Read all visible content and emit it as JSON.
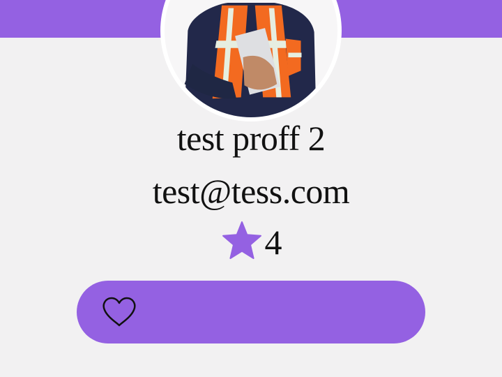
{
  "profile": {
    "name": "test proff 2",
    "email": "test@tess.com",
    "rating": "4",
    "avatar_icon": "worker-photo"
  },
  "icons": {
    "rating": "star-icon",
    "favorite": "heart-icon"
  },
  "colors": {
    "accent": "#9461e2",
    "background": "#f2f1f2",
    "text": "#111111"
  }
}
